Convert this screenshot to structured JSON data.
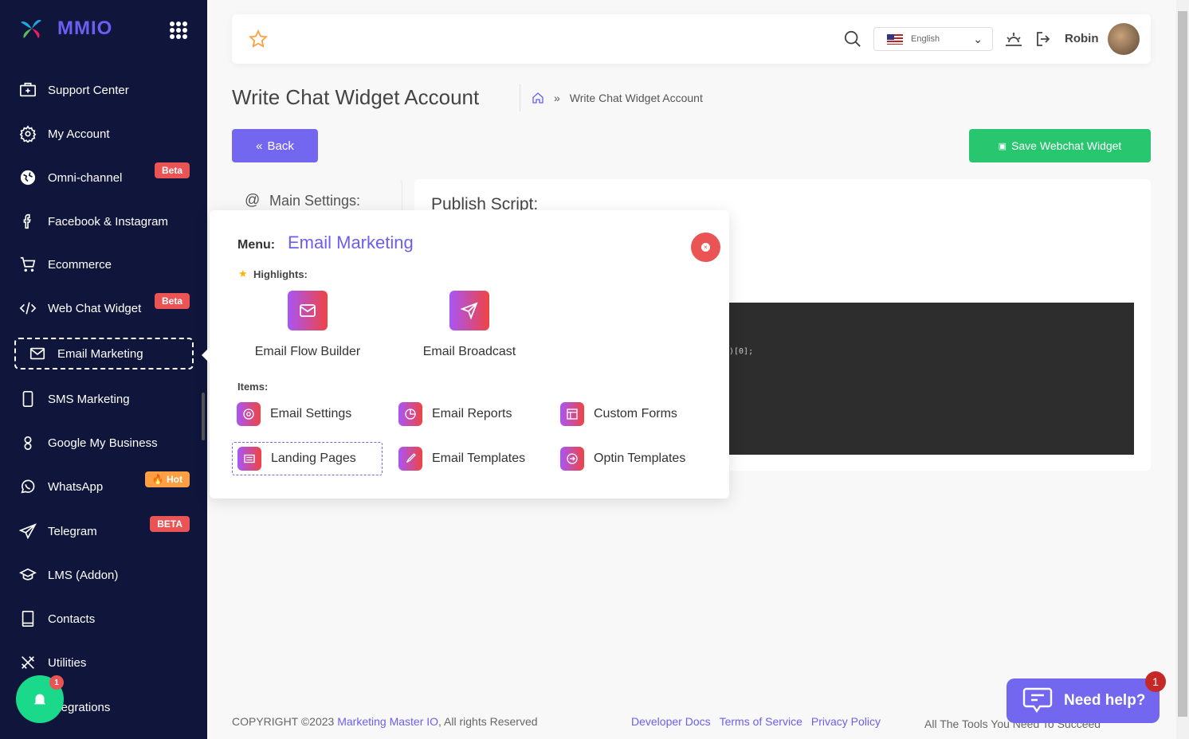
{
  "brand": {
    "name": "MMIO"
  },
  "sidebar": {
    "items": [
      {
        "label": "Support Center",
        "icon": "first-aid-icon"
      },
      {
        "label": "My Account",
        "icon": "gear-icon"
      },
      {
        "label": "Omni-channel",
        "icon": "globe-icon",
        "badge": "Beta"
      },
      {
        "label": "Facebook & Instagram",
        "icon": "facebook-icon"
      },
      {
        "label": "Ecommerce",
        "icon": "cart-icon"
      },
      {
        "label": "Web Chat Widget",
        "icon": "code-icon",
        "badge": "Beta"
      },
      {
        "label": "Email Marketing",
        "icon": "mail-icon",
        "active": true
      },
      {
        "label": "SMS Marketing",
        "icon": "phone-icon"
      },
      {
        "label": "Google My Business",
        "icon": "google-icon"
      },
      {
        "label": "WhatsApp",
        "icon": "whatsapp-icon",
        "badge": "🔥 Hot"
      },
      {
        "label": "Telegram",
        "icon": "telegram-icon",
        "badge": "BETA"
      },
      {
        "label": "LMS (Addon)",
        "icon": "graduation-icon"
      },
      {
        "label": "Contacts",
        "icon": "book-icon"
      },
      {
        "label": "Utilities",
        "icon": "tools-icon"
      },
      {
        "label": "Integrations",
        "icon": "plug-icon"
      }
    ],
    "notification_count": "1"
  },
  "header": {
    "language": "English",
    "user": "Robin"
  },
  "page": {
    "title": "Write Chat Widget Account",
    "breadcrumb": "Write Chat Widget Account",
    "back": "Back",
    "save": "Save Webchat Widget",
    "main_settings": "Main Settings:",
    "publish_script": "Publish Script:",
    "code_fragment": ")[0];"
  },
  "popup": {
    "menu_label": "Menu:",
    "menu_name": "Email Marketing",
    "highlights_label": "Highlights:",
    "highlights": [
      "Email Flow Builder",
      "Email Broadcast"
    ],
    "items_label": "Items:",
    "items": [
      "Email Settings",
      "Email Reports",
      "Custom Forms",
      "Landing Pages",
      "Email Templates",
      "Optin Templates"
    ]
  },
  "footer": {
    "copyright_prefix": "COPYRIGHT ©2023 ",
    "company": "Marketing Master IO",
    "copyright_suffix": ", All rights Reserved",
    "links": [
      "Developer Docs",
      "Terms of Service",
      "Privacy Policy"
    ],
    "tagline": "All The Tools You Need To Succeed"
  },
  "help": {
    "label": "Need help?",
    "count": "1"
  },
  "colors": {
    "sidebar": "#10163b",
    "accent": "#7367f0",
    "success": "#28c76f",
    "danger": "#ea5455"
  }
}
